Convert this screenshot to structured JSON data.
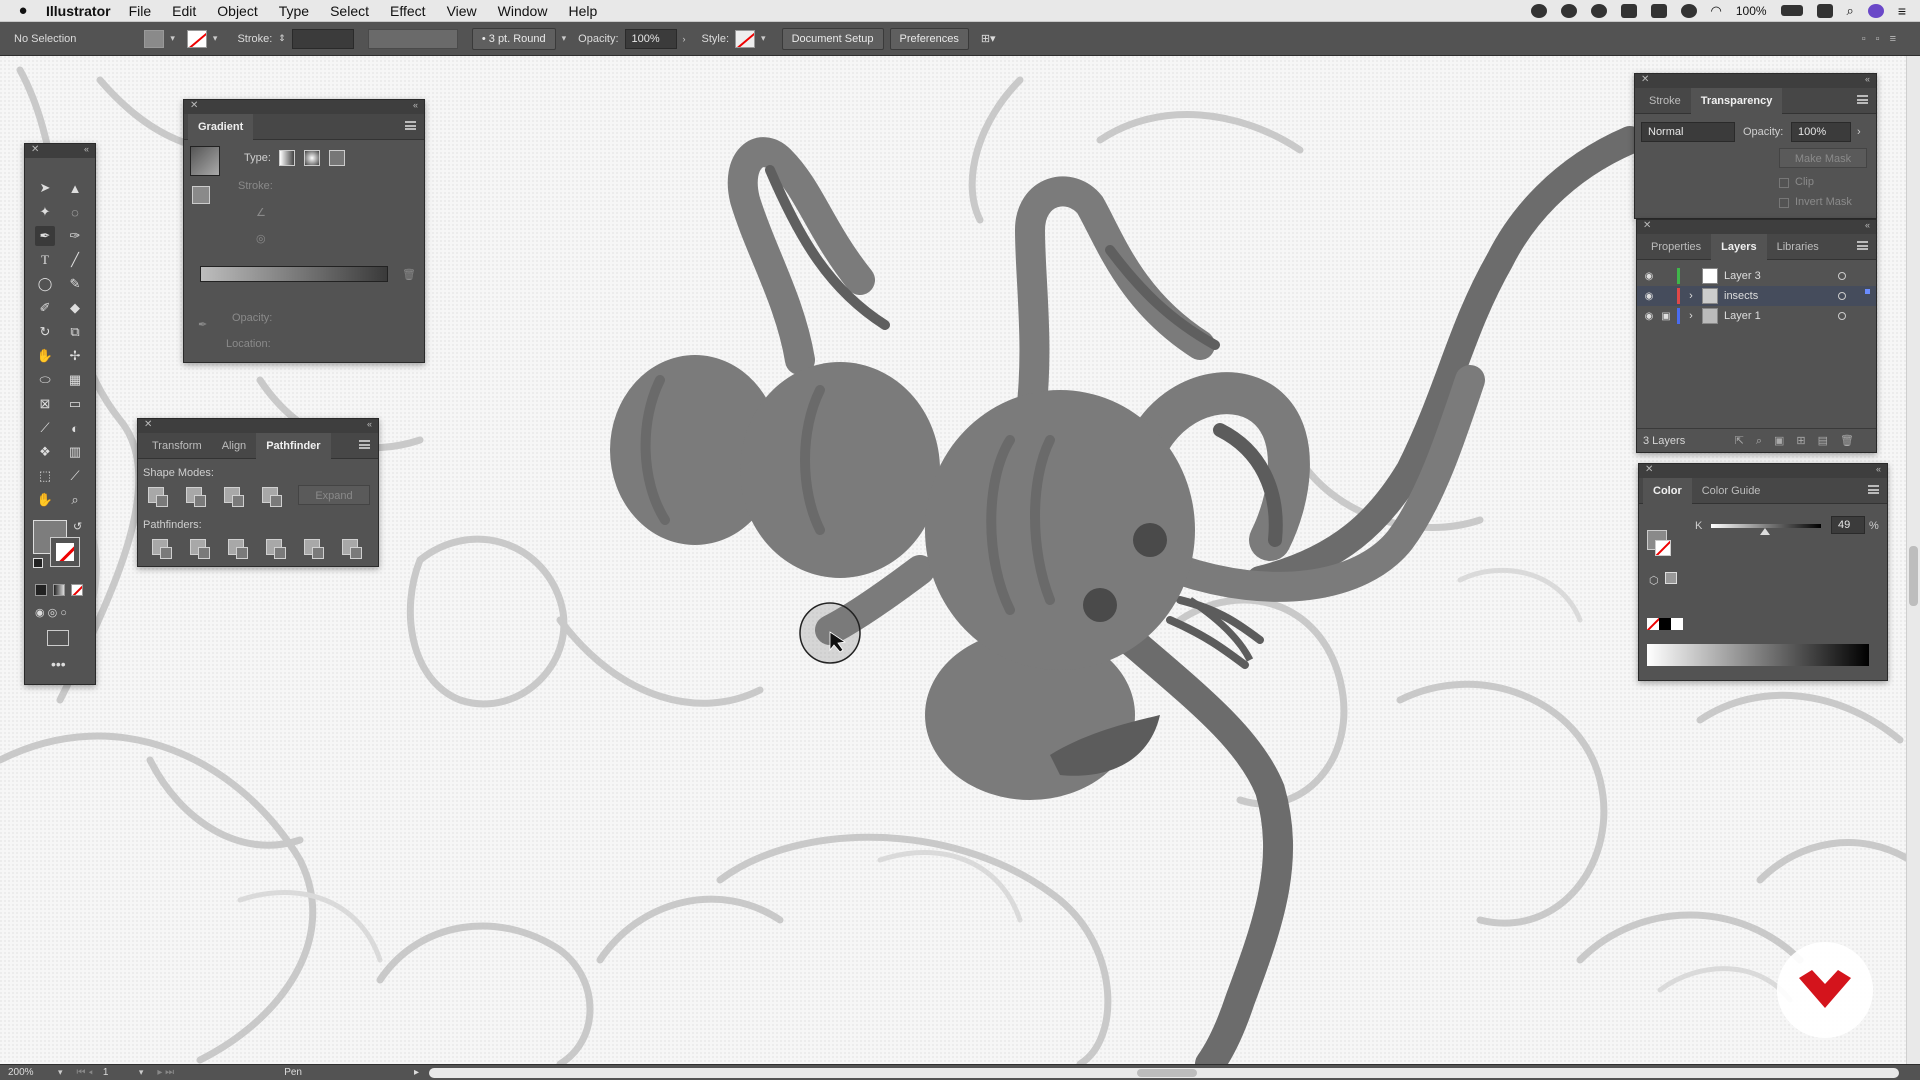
{
  "menubar": {
    "app": "Illustrator",
    "items": [
      "File",
      "Edit",
      "Object",
      "Type",
      "Select",
      "Effect",
      "View",
      "Window",
      "Help"
    ],
    "battery": "100%"
  },
  "controlbar": {
    "selection": "No Selection",
    "stroke_label": "Stroke:",
    "brush": "3 pt. Round",
    "opacity_label": "Opacity:",
    "opacity_value": "100%",
    "style_label": "Style:",
    "document_setup": "Document Setup",
    "preferences": "Preferences"
  },
  "gradient_panel": {
    "title": "Gradient",
    "type_label": "Type:",
    "stroke_label": "Stroke:",
    "opacity_label": "Opacity:",
    "location_label": "Location:"
  },
  "pathfinder_panel": {
    "tabs": [
      "Transform",
      "Align",
      "Pathfinder"
    ],
    "shape_modes_label": "Shape Modes:",
    "expand_label": "Expand",
    "pathfinders_label": "Pathfinders:"
  },
  "transparency_panel": {
    "tabs": [
      "Stroke",
      "Transparency"
    ],
    "blend_mode": "Normal",
    "opacity_label": "Opacity:",
    "opacity_value": "100%",
    "make_mask": "Make Mask",
    "clip": "Clip",
    "invert_mask": "Invert Mask"
  },
  "layers_panel": {
    "tabs": [
      "Properties",
      "Layers",
      "Libraries"
    ],
    "layers": [
      {
        "name": "Layer 3",
        "color": "#3fb64a"
      },
      {
        "name": "insects",
        "color": "#e04848"
      },
      {
        "name": "Layer 1",
        "color": "#4a6cf0"
      }
    ],
    "count": "3 Layers"
  },
  "color_panel": {
    "tabs": [
      "Color",
      "Color Guide"
    ],
    "channel": "K",
    "value": "49",
    "unit": "%",
    "k_fraction": 0.49
  },
  "statusbar": {
    "zoom": "200%",
    "artboard": "1",
    "tool": "Pen"
  },
  "colors": {
    "ui_panel": "#535353",
    "ui_dark": "#3e3e3e",
    "insect_body": "#7a7a7a",
    "insect_dark": "#5c5c5c",
    "brand_mark": "#d4141c"
  }
}
